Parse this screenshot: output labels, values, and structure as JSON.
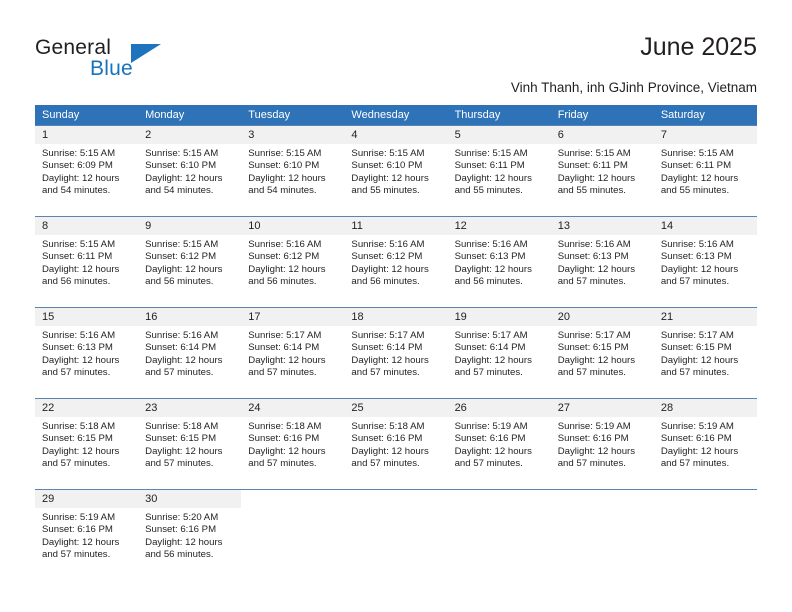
{
  "logo": {
    "line1": "General",
    "line2": "Blue",
    "triangle_color": "#1d74bd"
  },
  "header": {
    "title": "June 2025",
    "subtitle": "Vinh Thanh, inh GJinh Province, Vietnam"
  },
  "theme": {
    "header_blue": "#2e72b8",
    "row_line": "#5b85b0",
    "daynum_bg": "#f1f1f1",
    "text": "#231f20",
    "logo_blue": "#1673bd"
  },
  "calendar": {
    "weekdays": [
      "Sunday",
      "Monday",
      "Tuesday",
      "Wednesday",
      "Thursday",
      "Friday",
      "Saturday"
    ],
    "labels": {
      "sunrise": "Sunrise:",
      "sunset": "Sunset:",
      "daylight": "Daylight:"
    },
    "weeks": [
      [
        {
          "day": "1",
          "sunrise": "Sunrise: 5:15 AM",
          "sunset": "Sunset: 6:09 PM",
          "daylight1": "Daylight: 12 hours",
          "daylight2": "and 54 minutes."
        },
        {
          "day": "2",
          "sunrise": "Sunrise: 5:15 AM",
          "sunset": "Sunset: 6:10 PM",
          "daylight1": "Daylight: 12 hours",
          "daylight2": "and 54 minutes."
        },
        {
          "day": "3",
          "sunrise": "Sunrise: 5:15 AM",
          "sunset": "Sunset: 6:10 PM",
          "daylight1": "Daylight: 12 hours",
          "daylight2": "and 54 minutes."
        },
        {
          "day": "4",
          "sunrise": "Sunrise: 5:15 AM",
          "sunset": "Sunset: 6:10 PM",
          "daylight1": "Daylight: 12 hours",
          "daylight2": "and 55 minutes."
        },
        {
          "day": "5",
          "sunrise": "Sunrise: 5:15 AM",
          "sunset": "Sunset: 6:11 PM",
          "daylight1": "Daylight: 12 hours",
          "daylight2": "and 55 minutes."
        },
        {
          "day": "6",
          "sunrise": "Sunrise: 5:15 AM",
          "sunset": "Sunset: 6:11 PM",
          "daylight1": "Daylight: 12 hours",
          "daylight2": "and 55 minutes."
        },
        {
          "day": "7",
          "sunrise": "Sunrise: 5:15 AM",
          "sunset": "Sunset: 6:11 PM",
          "daylight1": "Daylight: 12 hours",
          "daylight2": "and 55 minutes."
        }
      ],
      [
        {
          "day": "8",
          "sunrise": "Sunrise: 5:15 AM",
          "sunset": "Sunset: 6:11 PM",
          "daylight1": "Daylight: 12 hours",
          "daylight2": "and 56 minutes."
        },
        {
          "day": "9",
          "sunrise": "Sunrise: 5:15 AM",
          "sunset": "Sunset: 6:12 PM",
          "daylight1": "Daylight: 12 hours",
          "daylight2": "and 56 minutes."
        },
        {
          "day": "10",
          "sunrise": "Sunrise: 5:16 AM",
          "sunset": "Sunset: 6:12 PM",
          "daylight1": "Daylight: 12 hours",
          "daylight2": "and 56 minutes."
        },
        {
          "day": "11",
          "sunrise": "Sunrise: 5:16 AM",
          "sunset": "Sunset: 6:12 PM",
          "daylight1": "Daylight: 12 hours",
          "daylight2": "and 56 minutes."
        },
        {
          "day": "12",
          "sunrise": "Sunrise: 5:16 AM",
          "sunset": "Sunset: 6:13 PM",
          "daylight1": "Daylight: 12 hours",
          "daylight2": "and 56 minutes."
        },
        {
          "day": "13",
          "sunrise": "Sunrise: 5:16 AM",
          "sunset": "Sunset: 6:13 PM",
          "daylight1": "Daylight: 12 hours",
          "daylight2": "and 57 minutes."
        },
        {
          "day": "14",
          "sunrise": "Sunrise: 5:16 AM",
          "sunset": "Sunset: 6:13 PM",
          "daylight1": "Daylight: 12 hours",
          "daylight2": "and 57 minutes."
        }
      ],
      [
        {
          "day": "15",
          "sunrise": "Sunrise: 5:16 AM",
          "sunset": "Sunset: 6:13 PM",
          "daylight1": "Daylight: 12 hours",
          "daylight2": "and 57 minutes."
        },
        {
          "day": "16",
          "sunrise": "Sunrise: 5:16 AM",
          "sunset": "Sunset: 6:14 PM",
          "daylight1": "Daylight: 12 hours",
          "daylight2": "and 57 minutes."
        },
        {
          "day": "17",
          "sunrise": "Sunrise: 5:17 AM",
          "sunset": "Sunset: 6:14 PM",
          "daylight1": "Daylight: 12 hours",
          "daylight2": "and 57 minutes."
        },
        {
          "day": "18",
          "sunrise": "Sunrise: 5:17 AM",
          "sunset": "Sunset: 6:14 PM",
          "daylight1": "Daylight: 12 hours",
          "daylight2": "and 57 minutes."
        },
        {
          "day": "19",
          "sunrise": "Sunrise: 5:17 AM",
          "sunset": "Sunset: 6:14 PM",
          "daylight1": "Daylight: 12 hours",
          "daylight2": "and 57 minutes."
        },
        {
          "day": "20",
          "sunrise": "Sunrise: 5:17 AM",
          "sunset": "Sunset: 6:15 PM",
          "daylight1": "Daylight: 12 hours",
          "daylight2": "and 57 minutes."
        },
        {
          "day": "21",
          "sunrise": "Sunrise: 5:17 AM",
          "sunset": "Sunset: 6:15 PM",
          "daylight1": "Daylight: 12 hours",
          "daylight2": "and 57 minutes."
        }
      ],
      [
        {
          "day": "22",
          "sunrise": "Sunrise: 5:18 AM",
          "sunset": "Sunset: 6:15 PM",
          "daylight1": "Daylight: 12 hours",
          "daylight2": "and 57 minutes."
        },
        {
          "day": "23",
          "sunrise": "Sunrise: 5:18 AM",
          "sunset": "Sunset: 6:15 PM",
          "daylight1": "Daylight: 12 hours",
          "daylight2": "and 57 minutes."
        },
        {
          "day": "24",
          "sunrise": "Sunrise: 5:18 AM",
          "sunset": "Sunset: 6:16 PM",
          "daylight1": "Daylight: 12 hours",
          "daylight2": "and 57 minutes."
        },
        {
          "day": "25",
          "sunrise": "Sunrise: 5:18 AM",
          "sunset": "Sunset: 6:16 PM",
          "daylight1": "Daylight: 12 hours",
          "daylight2": "and 57 minutes."
        },
        {
          "day": "26",
          "sunrise": "Sunrise: 5:19 AM",
          "sunset": "Sunset: 6:16 PM",
          "daylight1": "Daylight: 12 hours",
          "daylight2": "and 57 minutes."
        },
        {
          "day": "27",
          "sunrise": "Sunrise: 5:19 AM",
          "sunset": "Sunset: 6:16 PM",
          "daylight1": "Daylight: 12 hours",
          "daylight2": "and 57 minutes."
        },
        {
          "day": "28",
          "sunrise": "Sunrise: 5:19 AM",
          "sunset": "Sunset: 6:16 PM",
          "daylight1": "Daylight: 12 hours",
          "daylight2": "and 57 minutes."
        }
      ],
      [
        {
          "day": "29",
          "sunrise": "Sunrise: 5:19 AM",
          "sunset": "Sunset: 6:16 PM",
          "daylight1": "Daylight: 12 hours",
          "daylight2": "and 57 minutes."
        },
        {
          "day": "30",
          "sunrise": "Sunrise: 5:20 AM",
          "sunset": "Sunset: 6:16 PM",
          "daylight1": "Daylight: 12 hours",
          "daylight2": "and 56 minutes."
        },
        {
          "day": "",
          "sunrise": "",
          "sunset": "",
          "daylight1": "",
          "daylight2": ""
        },
        {
          "day": "",
          "sunrise": "",
          "sunset": "",
          "daylight1": "",
          "daylight2": ""
        },
        {
          "day": "",
          "sunrise": "",
          "sunset": "",
          "daylight1": "",
          "daylight2": ""
        },
        {
          "day": "",
          "sunrise": "",
          "sunset": "",
          "daylight1": "",
          "daylight2": ""
        },
        {
          "day": "",
          "sunrise": "",
          "sunset": "",
          "daylight1": "",
          "daylight2": ""
        }
      ]
    ]
  }
}
